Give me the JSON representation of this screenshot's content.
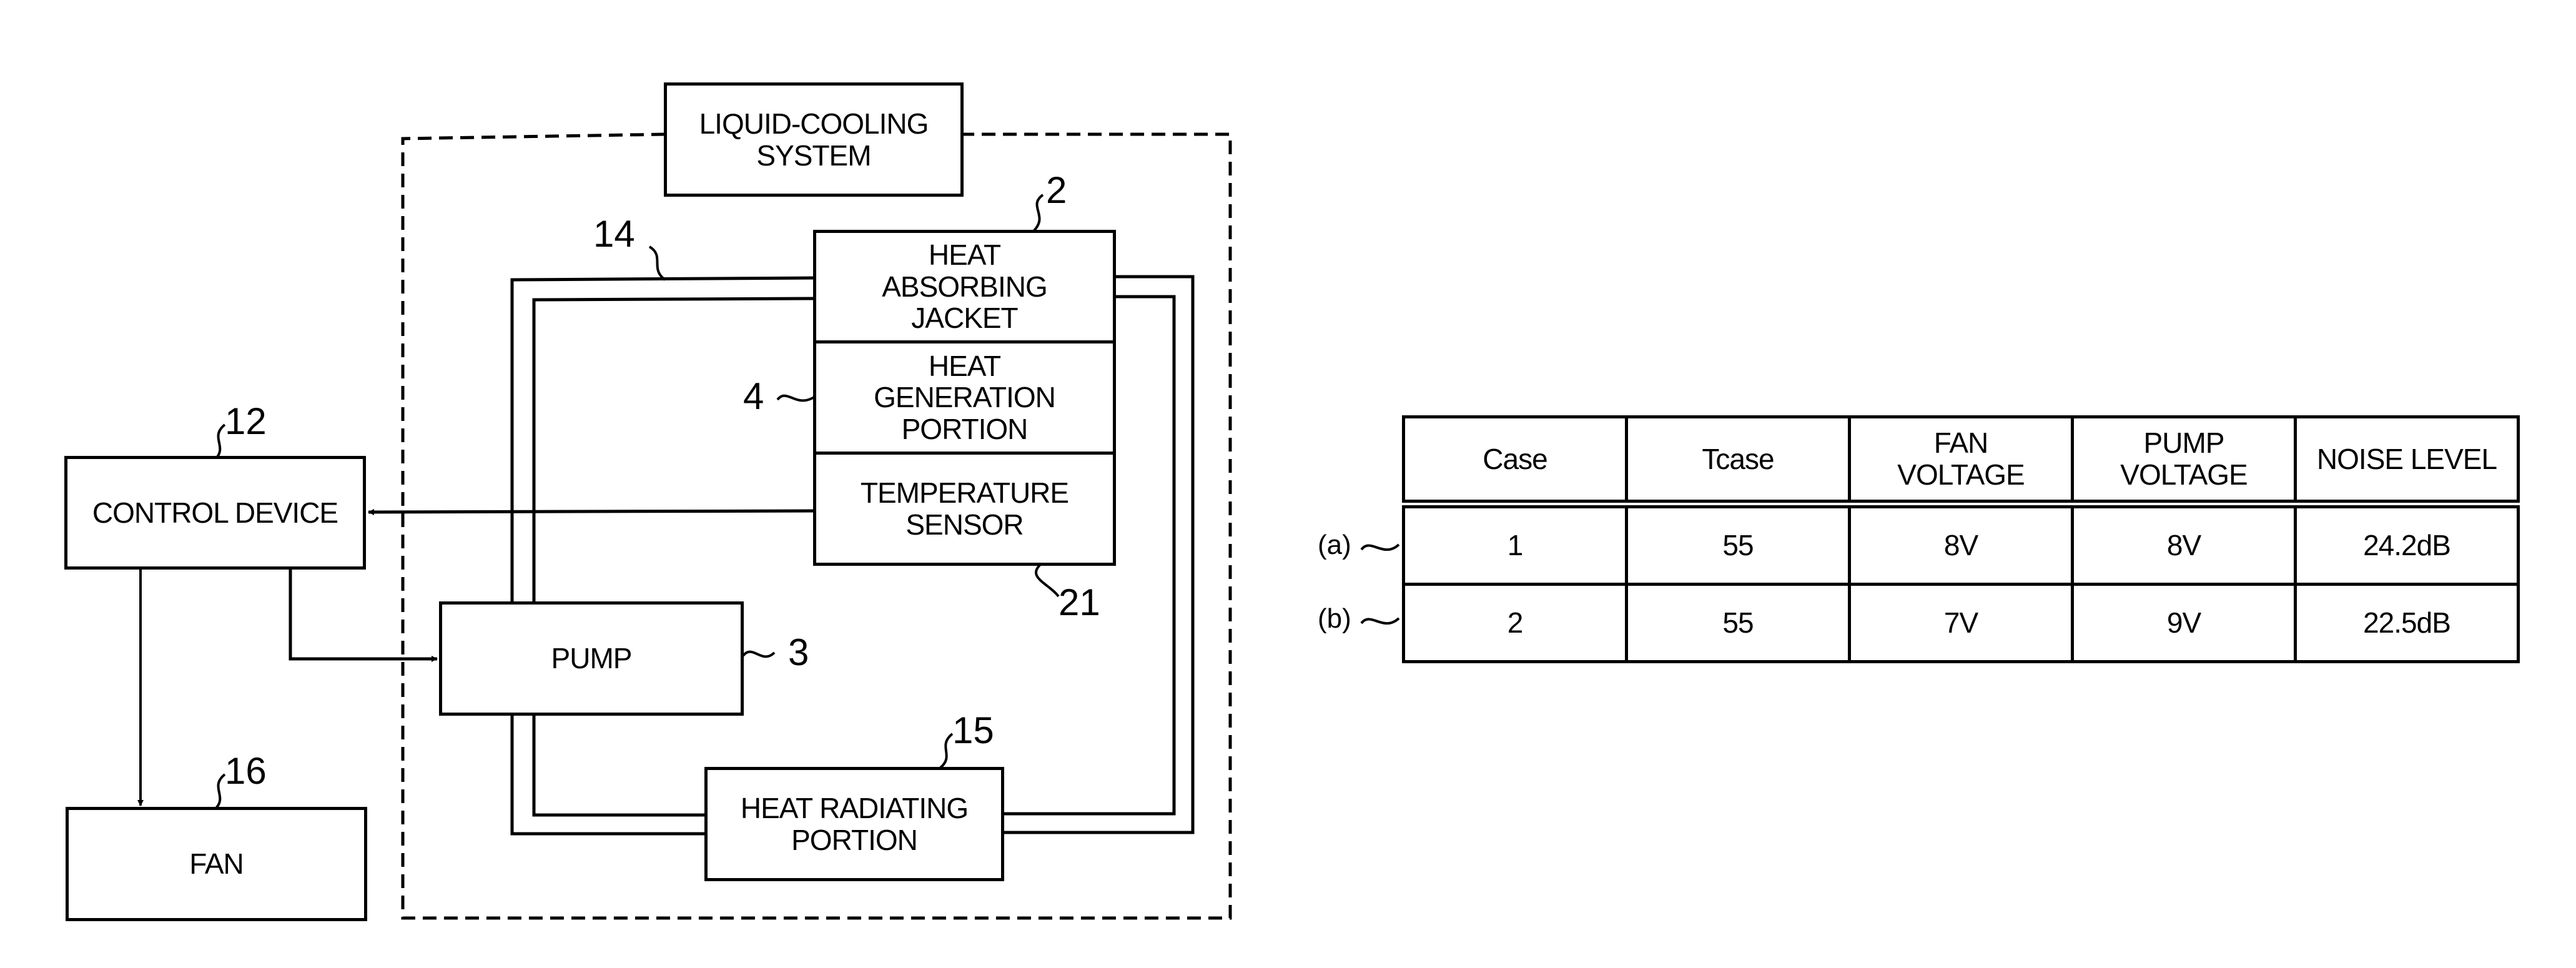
{
  "diagram": {
    "system_label": "LIQUID-COOLING\nSYSTEM",
    "blocks": {
      "heat_absorbing_jacket": "HEAT\nABSORBING\nJACKET",
      "heat_generation_portion": "HEAT\nGENERATION\nPORTION",
      "temperature_sensor": "TEMPERATURE\nSENSOR",
      "control_device": "CONTROL DEVICE",
      "pump": "PUMP",
      "heat_radiating_portion": "HEAT RADIATING\nPORTION",
      "fan": "FAN"
    },
    "refs": {
      "jacket": "2",
      "pipe": "14",
      "heat_generation": "4",
      "control_device": "12",
      "sensor": "21",
      "pump": "3",
      "radiator": "15",
      "fan": "16"
    }
  },
  "table": {
    "headers": [
      "Case",
      "Tcase",
      "FAN\nVOLTAGE",
      "PUMP\nVOLTAGE",
      "NOISE LEVEL"
    ],
    "rows": [
      {
        "label": "(a)",
        "cells": [
          "1",
          "55",
          "8V",
          "8V",
          "24.2dB"
        ]
      },
      {
        "label": "(b)",
        "cells": [
          "2",
          "55",
          "7V",
          "9V",
          "22.5dB"
        ]
      }
    ]
  }
}
